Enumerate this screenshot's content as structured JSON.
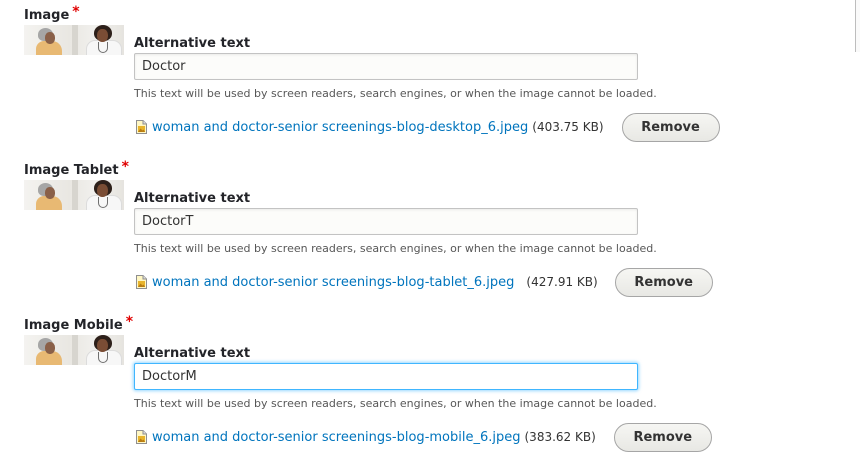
{
  "fields": [
    {
      "label": "Image",
      "required_mark": "*",
      "alt_label": "Alternative text",
      "alt_value": "Doctor",
      "description": "This text will be used by screen readers, search engines, or when the image cannot be loaded.",
      "file_name": "woman and doctor-senior screenings-blog-desktop_6.jpeg",
      "file_size": "(403.75 KB)",
      "remove_label": "Remove"
    },
    {
      "label": "Image Tablet",
      "required_mark": "*",
      "alt_label": "Alternative text",
      "alt_value": "DoctorT",
      "description": "This text will be used by screen readers, search engines, or when the image cannot be loaded.",
      "file_name": "woman and doctor-senior screenings-blog-tablet_6.jpeg",
      "file_size": "(427.91 KB)",
      "remove_label": "Remove"
    },
    {
      "label": "Image Mobile",
      "required_mark": "*",
      "alt_label": "Alternative text",
      "alt_value": "DoctorM",
      "description": "This text will be used by screen readers, search engines, or when the image cannot be loaded.",
      "file_name": "woman and doctor-senior screenings-blog-mobile_6.jpeg",
      "file_size": "(383.62 KB)",
      "remove_label": "Remove"
    }
  ],
  "colors": {
    "link": "#0074bd",
    "required": "#e00000",
    "focus": "#40b6ff"
  },
  "icons": {
    "file": "image-file-icon",
    "thumbnail": "image-thumbnail"
  }
}
